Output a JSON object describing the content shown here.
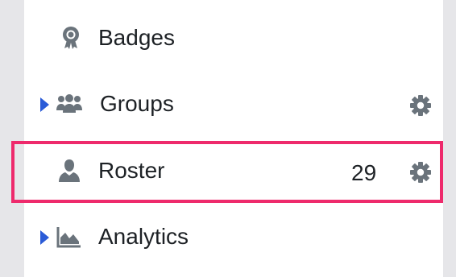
{
  "nav": {
    "items": [
      {
        "label": "Badges",
        "icon": "badge-ribbon-icon"
      },
      {
        "label": "Groups",
        "icon": "users-group-icon",
        "expandable": true,
        "settings_icon": "gear-icon"
      },
      {
        "label": "Roster",
        "icon": "user-icon",
        "count": "29",
        "settings_icon": "gear-icon",
        "highlighted": true
      },
      {
        "label": "Analytics",
        "icon": "area-chart-icon",
        "expandable": true
      }
    ]
  },
  "colors": {
    "caret": "#2a5bd7",
    "highlight": "#ee2a6c",
    "icon": "#6a737b",
    "text": "#1d2125"
  }
}
